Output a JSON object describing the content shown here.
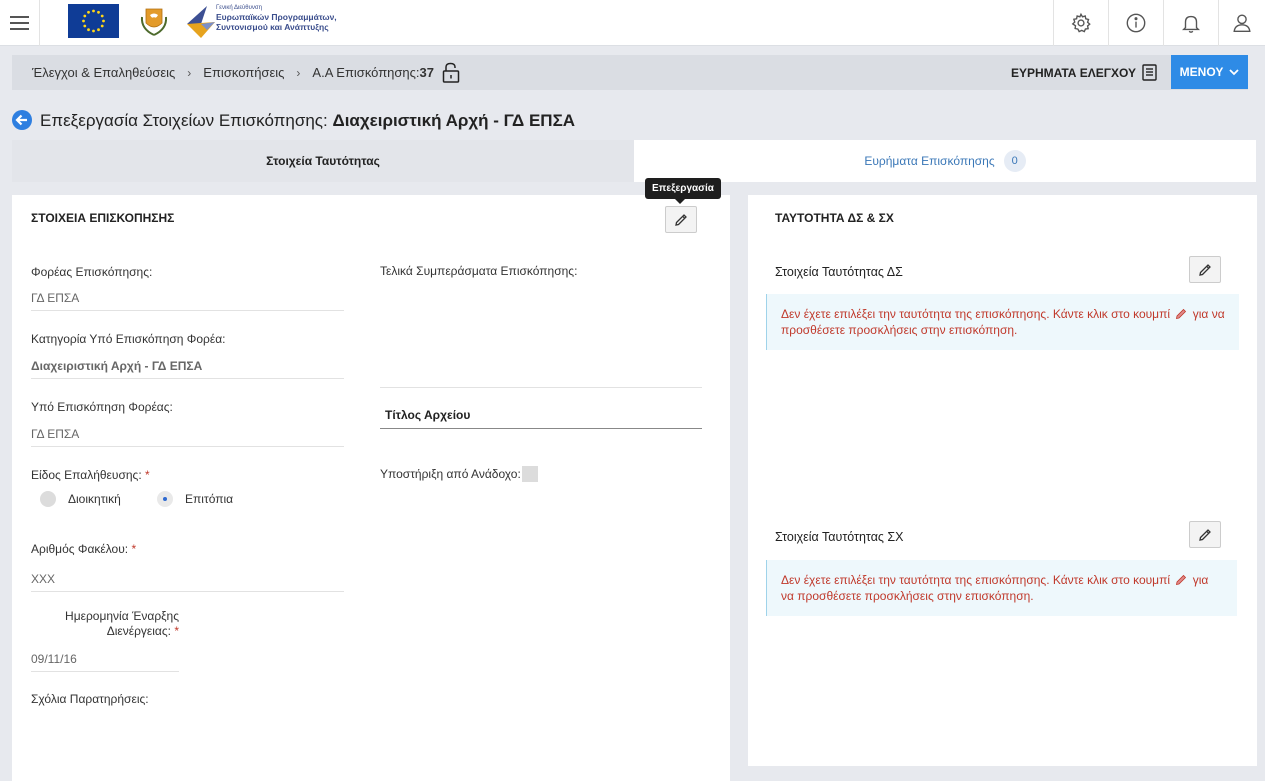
{
  "header": {
    "espa_logo_small": "Γενική Διεύθυνση",
    "espa_logo_line1": "Ευρωπαϊκών Προγραμμάτων,",
    "espa_logo_line2": "Συντονισμού και Ανάπτυξης",
    "icons": [
      "gear-icon",
      "info-icon",
      "bell-icon",
      "user-icon"
    ]
  },
  "breadcrumb": {
    "items": [
      "Έλεγχοι & Επαληθεύσεις",
      "Επισκοπήσεις"
    ],
    "current_label": "Α.Α Επισκόπησης:",
    "current_value": "37",
    "findings_label": "ΕΥΡΗΜΑΤΑ ΕΛΕΓΧΟΥ",
    "menu_label": "ΜΕΝΟΥ"
  },
  "page": {
    "title_prefix": "Επεξεργασία Στοιχείων Επισκόπησης:",
    "title_bold": "Διαχειριστική Αρχή - ΓΔ ΕΠΣΑ"
  },
  "tabs": {
    "identity": "Στοιχεία Ταυτότητας",
    "findings": "Ευρήματα Επισκόπησης",
    "findings_count": "0"
  },
  "left": {
    "title": "ΣΤΟΙΧΕΙΑ ΕΠΙΣΚΟΠΗΣΗΣ",
    "tooltip": "Επεξεργασία",
    "fields": {
      "body_label": "Φορέας Επισκόπησης:",
      "body_value": "ΓΔ ΕΠΣΑ",
      "category_label": "Κατηγορία Υπό Επισκόπηση Φορέα:",
      "category_value": "Διαχειριστική Αρχή - ΓΔ ΕΠΣΑ",
      "under_label": "Υπό Επισκόπηση Φορέας:",
      "under_value": "ΓΔ ΕΠΣΑ",
      "type_label": "Είδος Επαλήθευσης:",
      "type_options": [
        "Διοικητική",
        "Επιτόπια"
      ],
      "file_label": "Αριθμός Φακέλου:",
      "file_value": "XXX",
      "date_label_1": "Ημερομηνία Έναρξης",
      "date_label_2": "Διενέργειας:",
      "date_value": "09/11/16",
      "comments_label": "Σχόλια Παρατηρήσεις:",
      "conclusions_label": "Τελικά Συμπεράσματα Επισκόπησης:",
      "file_title_header": "Τίτλος Αρχείου",
      "support_label": "Υποστήριξη από Ανάδοχο:"
    },
    "required_mark": "*"
  },
  "right": {
    "title": "ΤΑΥΤΟΤΗΤΑ ΔΣ & ΣΧ",
    "ds_label": "Στοιχεία Ταυτότητας ΔΣ",
    "sx_label": "Στοιχεία Ταυτότητας ΣΧ",
    "alert_part1": "Δεν έχετε επιλέξει την ταυτότητα της επισκόπησης. Κάντε κλικ στο κουμπί",
    "alert_part2": "για",
    "alert_part3": "να προσθέσετε προσκλήσεις στην επισκόπηση."
  }
}
